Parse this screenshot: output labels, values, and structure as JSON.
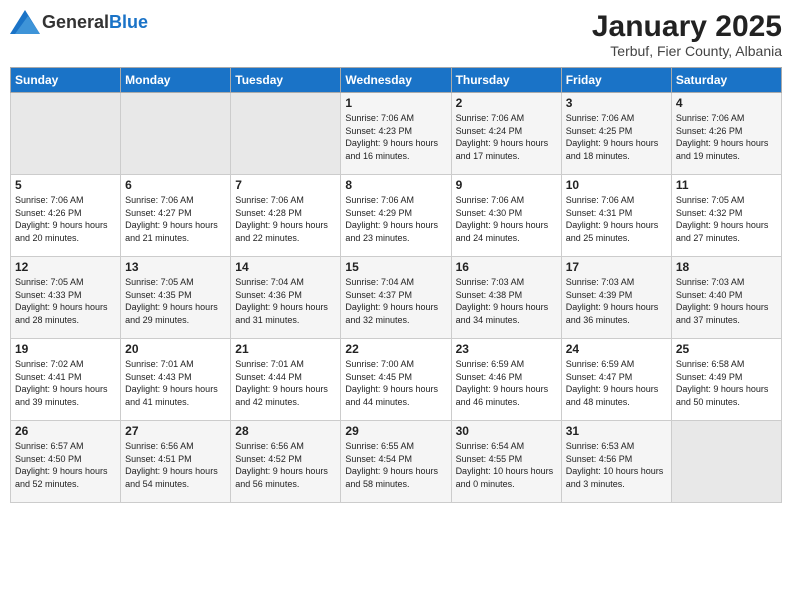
{
  "header": {
    "logo": {
      "general": "General",
      "blue": "Blue"
    },
    "title": "January 2025",
    "location": "Terbuf, Fier County, Albania"
  },
  "calendar": {
    "weekdays": [
      "Sunday",
      "Monday",
      "Tuesday",
      "Wednesday",
      "Thursday",
      "Friday",
      "Saturday"
    ],
    "weeks": [
      [
        {
          "day": "",
          "empty": true
        },
        {
          "day": "",
          "empty": true
        },
        {
          "day": "",
          "empty": true
        },
        {
          "day": "1",
          "sunrise": "7:06 AM",
          "sunset": "4:23 PM",
          "daylight": "9 hours and 16 minutes."
        },
        {
          "day": "2",
          "sunrise": "7:06 AM",
          "sunset": "4:24 PM",
          "daylight": "9 hours and 17 minutes."
        },
        {
          "day": "3",
          "sunrise": "7:06 AM",
          "sunset": "4:25 PM",
          "daylight": "9 hours and 18 minutes."
        },
        {
          "day": "4",
          "sunrise": "7:06 AM",
          "sunset": "4:26 PM",
          "daylight": "9 hours and 19 minutes."
        }
      ],
      [
        {
          "day": "5",
          "sunrise": "7:06 AM",
          "sunset": "4:26 PM",
          "daylight": "9 hours and 20 minutes."
        },
        {
          "day": "6",
          "sunrise": "7:06 AM",
          "sunset": "4:27 PM",
          "daylight": "9 hours and 21 minutes."
        },
        {
          "day": "7",
          "sunrise": "7:06 AM",
          "sunset": "4:28 PM",
          "daylight": "9 hours and 22 minutes."
        },
        {
          "day": "8",
          "sunrise": "7:06 AM",
          "sunset": "4:29 PM",
          "daylight": "9 hours and 23 minutes."
        },
        {
          "day": "9",
          "sunrise": "7:06 AM",
          "sunset": "4:30 PM",
          "daylight": "9 hours and 24 minutes."
        },
        {
          "day": "10",
          "sunrise": "7:06 AM",
          "sunset": "4:31 PM",
          "daylight": "9 hours and 25 minutes."
        },
        {
          "day": "11",
          "sunrise": "7:05 AM",
          "sunset": "4:32 PM",
          "daylight": "9 hours and 27 minutes."
        }
      ],
      [
        {
          "day": "12",
          "sunrise": "7:05 AM",
          "sunset": "4:33 PM",
          "daylight": "9 hours and 28 minutes."
        },
        {
          "day": "13",
          "sunrise": "7:05 AM",
          "sunset": "4:35 PM",
          "daylight": "9 hours and 29 minutes."
        },
        {
          "day": "14",
          "sunrise": "7:04 AM",
          "sunset": "4:36 PM",
          "daylight": "9 hours and 31 minutes."
        },
        {
          "day": "15",
          "sunrise": "7:04 AM",
          "sunset": "4:37 PM",
          "daylight": "9 hours and 32 minutes."
        },
        {
          "day": "16",
          "sunrise": "7:03 AM",
          "sunset": "4:38 PM",
          "daylight": "9 hours and 34 minutes."
        },
        {
          "day": "17",
          "sunrise": "7:03 AM",
          "sunset": "4:39 PM",
          "daylight": "9 hours and 36 minutes."
        },
        {
          "day": "18",
          "sunrise": "7:03 AM",
          "sunset": "4:40 PM",
          "daylight": "9 hours and 37 minutes."
        }
      ],
      [
        {
          "day": "19",
          "sunrise": "7:02 AM",
          "sunset": "4:41 PM",
          "daylight": "9 hours and 39 minutes."
        },
        {
          "day": "20",
          "sunrise": "7:01 AM",
          "sunset": "4:43 PM",
          "daylight": "9 hours and 41 minutes."
        },
        {
          "day": "21",
          "sunrise": "7:01 AM",
          "sunset": "4:44 PM",
          "daylight": "9 hours and 42 minutes."
        },
        {
          "day": "22",
          "sunrise": "7:00 AM",
          "sunset": "4:45 PM",
          "daylight": "9 hours and 44 minutes."
        },
        {
          "day": "23",
          "sunrise": "6:59 AM",
          "sunset": "4:46 PM",
          "daylight": "9 hours and 46 minutes."
        },
        {
          "day": "24",
          "sunrise": "6:59 AM",
          "sunset": "4:47 PM",
          "daylight": "9 hours and 48 minutes."
        },
        {
          "day": "25",
          "sunrise": "6:58 AM",
          "sunset": "4:49 PM",
          "daylight": "9 hours and 50 minutes."
        }
      ],
      [
        {
          "day": "26",
          "sunrise": "6:57 AM",
          "sunset": "4:50 PM",
          "daylight": "9 hours and 52 minutes."
        },
        {
          "day": "27",
          "sunrise": "6:56 AM",
          "sunset": "4:51 PM",
          "daylight": "9 hours and 54 minutes."
        },
        {
          "day": "28",
          "sunrise": "6:56 AM",
          "sunset": "4:52 PM",
          "daylight": "9 hours and 56 minutes."
        },
        {
          "day": "29",
          "sunrise": "6:55 AM",
          "sunset": "4:54 PM",
          "daylight": "9 hours and 58 minutes."
        },
        {
          "day": "30",
          "sunrise": "6:54 AM",
          "sunset": "4:55 PM",
          "daylight": "10 hours and 0 minutes."
        },
        {
          "day": "31",
          "sunrise": "6:53 AM",
          "sunset": "4:56 PM",
          "daylight": "10 hours and 3 minutes."
        },
        {
          "day": "",
          "empty": true
        }
      ]
    ],
    "labels": {
      "sunrise": "Sunrise:",
      "sunset": "Sunset:",
      "daylight": "Daylight:"
    }
  }
}
